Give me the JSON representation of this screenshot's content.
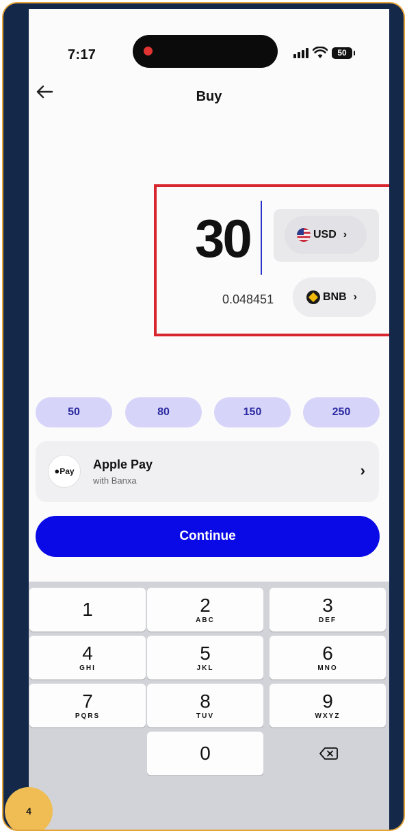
{
  "status_bar": {
    "time": "7:17",
    "battery": "50"
  },
  "nav": {
    "title": "Buy",
    "back_icon": "arrow-left-icon"
  },
  "amount": {
    "fiat_value": "30",
    "fiat_currency": "USD",
    "fiat_flag_icon": "us-flag-icon",
    "crypto_value": "0.048451",
    "crypto_currency": "BNB",
    "crypto_icon": "bnb-coin-icon"
  },
  "presets": [
    "50",
    "80",
    "150",
    "250"
  ],
  "payment": {
    "logo_text": "Pay",
    "title": "Apple Pay",
    "subtitle": "with Banxa"
  },
  "continue_label": "Continue",
  "keypad": [
    {
      "num": "1",
      "letters": ""
    },
    {
      "num": "2",
      "letters": "ABC"
    },
    {
      "num": "3",
      "letters": "DEF"
    },
    {
      "num": "4",
      "letters": "GHI"
    },
    {
      "num": "5",
      "letters": "JKL"
    },
    {
      "num": "6",
      "letters": "MNO"
    },
    {
      "num": "7",
      "letters": "PQRS"
    },
    {
      "num": "8",
      "letters": "TUV"
    },
    {
      "num": "9",
      "letters": "WXYZ"
    },
    {
      "num": "0",
      "letters": ""
    }
  ],
  "step_badge": "4",
  "colors": {
    "frame": "#14284a",
    "frame_border": "#e3a43a",
    "accent": "#0a0ae6",
    "preset_bg": "#d6d4f8",
    "highlight": "#d7262d",
    "badge": "#efbd54"
  }
}
